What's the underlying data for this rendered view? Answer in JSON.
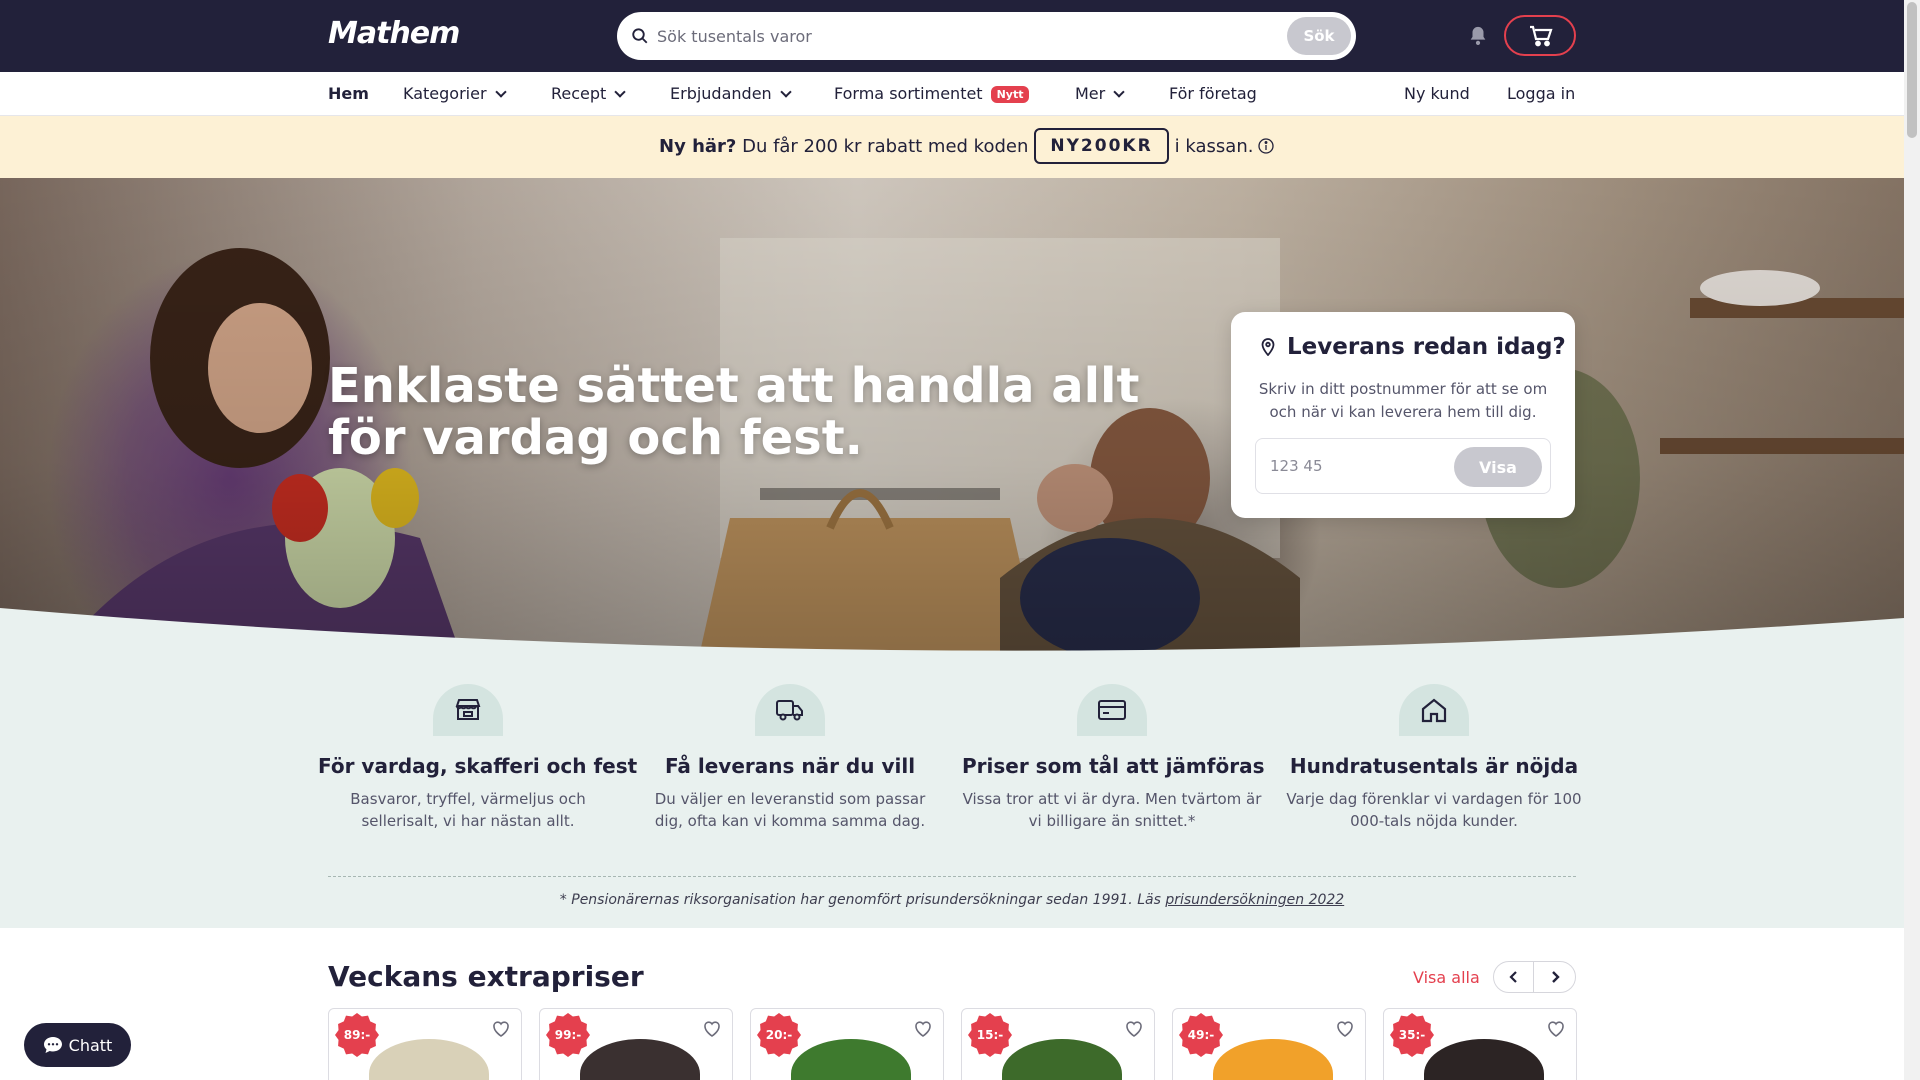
{
  "header": {
    "logo": "Mathem",
    "search_placeholder": "Sök tusentals varor",
    "search_button": "Sök"
  },
  "nav": {
    "items": [
      "Hem",
      "Kategorier",
      "Recept",
      "Erbjudanden",
      "Forma sortimentet",
      "Mer",
      "För företag"
    ],
    "new_badge": "Nytt",
    "right": [
      "Ny kund",
      "Logga in"
    ]
  },
  "promo": {
    "lead": "Ny här?",
    "text": "Du får 200 kr rabatt med koden",
    "code": "NY200KR",
    "tail": "i kassan."
  },
  "hero": {
    "title": "Enklaste sättet att handla allt för vardag och fest."
  },
  "delivery": {
    "title": "Leverans redan idag?",
    "text": "Skriv in ditt postnummer för att se om och när vi kan leverera hem till dig.",
    "placeholder": "123 45",
    "button": "Visa"
  },
  "usps": [
    {
      "icon": "store-icon",
      "title": "För vardag, skafferi och fest",
      "text": "Basvaror, tryffel, värmeljus och sellerisalt, vi har nästan allt."
    },
    {
      "icon": "truck-icon",
      "title": "Få leverans när du vill",
      "text": "Du väljer en leveranstid som passar dig, ofta kan vi komma samma dag."
    },
    {
      "icon": "wallet-icon",
      "title": "Priser som tål att jämföras",
      "text": "Vissa tror att vi är dyra. Men tvärtom är vi billigare än snittet.*"
    },
    {
      "icon": "home-icon",
      "title": "Hundratusentals är nöjda",
      "text": "Varje dag förenklar vi vardagen för 100 000-tals nöjda kunder."
    }
  ],
  "footnote": {
    "text": "* Pensionärernas riksorganisation har genomfört prisundersökningar sedan 1991. Läs ",
    "link": "prisundersökningen 2022"
  },
  "products": {
    "title": "Veckans extrapriser",
    "view_all": "Visa alla",
    "items": [
      {
        "price": "89:-",
        "color": "#d9d1b8"
      },
      {
        "price": "99:-",
        "color": "#3a3030"
      },
      {
        "price": "20:-",
        "color": "#3e7a2e"
      },
      {
        "price": "15:-",
        "color": "#3d6a2a"
      },
      {
        "price": "49:-",
        "color": "#f1a12a"
      },
      {
        "price": "35:-",
        "color": "#2c2424"
      }
    ]
  },
  "chat": {
    "label": "Chatt"
  },
  "colors": {
    "brand_dark": "#22213a",
    "accent": "#e4404e",
    "promo_bg": "#fdf1d5",
    "usp_bg": "#e9f1ef"
  }
}
